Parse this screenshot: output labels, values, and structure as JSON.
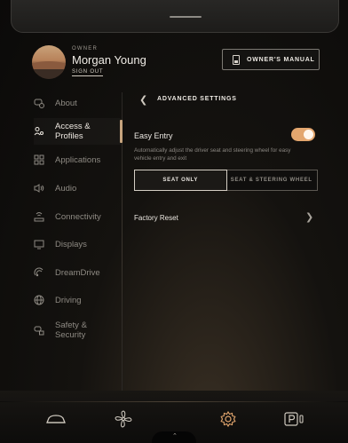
{
  "header": {
    "owner_label": "OWNER",
    "user_name": "Morgan Young",
    "sign_out_label": "SIGN OUT",
    "owners_manual_label": "OWNER'S MANUAL"
  },
  "sidebar": {
    "items": [
      {
        "label": "About",
        "icon": "car-info-icon",
        "active": false
      },
      {
        "label": "Access & Profiles",
        "icon": "person-key-icon",
        "active": true
      },
      {
        "label": "Applications",
        "icon": "grid-icon",
        "active": false
      },
      {
        "label": "Audio",
        "icon": "speaker-icon",
        "active": false
      },
      {
        "label": "Connectivity",
        "icon": "connectivity-icon",
        "active": false
      },
      {
        "label": "Displays",
        "icon": "display-icon",
        "active": false
      },
      {
        "label": "DreamDrive",
        "icon": "dreamdrive-icon",
        "active": false
      },
      {
        "label": "Driving",
        "icon": "globe-icon",
        "active": false
      },
      {
        "label": "Safety & Security",
        "icon": "safety-icon",
        "active": false
      }
    ]
  },
  "main": {
    "section_title": "ADVANCED SETTINGS",
    "easy_entry": {
      "label": "Easy Entry",
      "enabled": true,
      "description": "Automatically adjust the driver seat and steering wheel for easy vehicle entry and exit",
      "options": [
        "SEAT ONLY",
        "SEAT & STEERING WHEEL"
      ],
      "selected": "SEAT ONLY"
    },
    "factory_reset_label": "Factory Reset"
  },
  "dock": {
    "items": [
      "car-icon",
      "fan-icon",
      "settings-gear-icon",
      "park-assist-icon"
    ]
  },
  "colors": {
    "accent": "#e3a66e",
    "active_bar": "#c7a47e",
    "background": "#0b0a09"
  }
}
